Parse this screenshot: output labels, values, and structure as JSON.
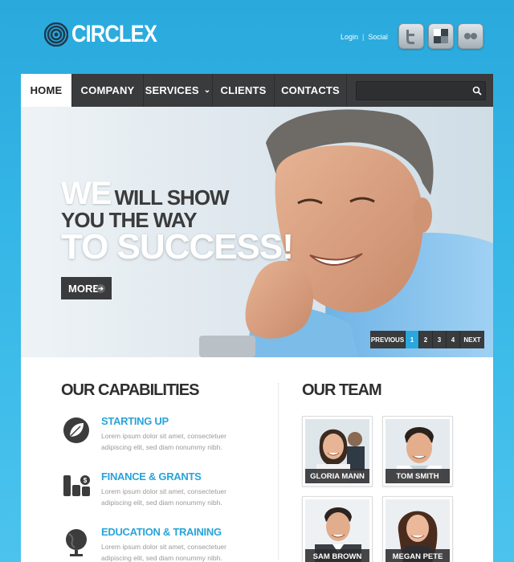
{
  "brand": {
    "name": "CIRCLEX"
  },
  "top_links": {
    "login": "Login",
    "separator": "|",
    "social": "Social"
  },
  "social_icons": [
    "twitter-icon",
    "delicious-icon",
    "flickr-icon"
  ],
  "nav": {
    "items": [
      {
        "label": "HOME",
        "active": true
      },
      {
        "label": "COMPANY"
      },
      {
        "label": "SERVICES"
      },
      {
        "label": "CLIENTS"
      },
      {
        "label": "CONTACTS"
      }
    ],
    "search_placeholder": ""
  },
  "hero": {
    "we": "WE",
    "will_show": "WILL SHOW",
    "you_the_way": "YOU THE WAY",
    "to_success": "TO SUCCESS!",
    "more": "MORE",
    "pager": {
      "prev": "PREVIOUS",
      "pages": [
        "1",
        "2",
        "3",
        "4"
      ],
      "active_page": "1",
      "next": "NEXT"
    }
  },
  "capabilities": {
    "title": "OUR CAPABILITIES",
    "items": [
      {
        "title": "STARTING UP",
        "text": "Lorem ipsum dolor sit amet, consectetuer adipiscing elit, sed diam nonummy nibh.",
        "icon": "leaf-icon"
      },
      {
        "title": "FINANCE & GRANTS",
        "text": "Lorem ipsum dolor sit amet, consectetuer adipiscing elit, sed diam nonummy nibh.",
        "icon": "coins-icon"
      },
      {
        "title": "EDUCATION & TRAINING",
        "text": "Lorem ipsum dolor sit amet, consectetuer adipiscing elit, sed diam nonummy nibh.",
        "icon": "globe-icon"
      }
    ]
  },
  "team": {
    "title": "OUR TEAM",
    "members": [
      {
        "name": "GLORIA MANN"
      },
      {
        "name": "TOM SMITH"
      },
      {
        "name": "SAM BROWN"
      },
      {
        "name": "MEGAN PETE"
      }
    ]
  },
  "colors": {
    "accent": "#2aa7dc",
    "nav_bg": "#3a3b3d",
    "page_bg": "#34b6e6"
  }
}
